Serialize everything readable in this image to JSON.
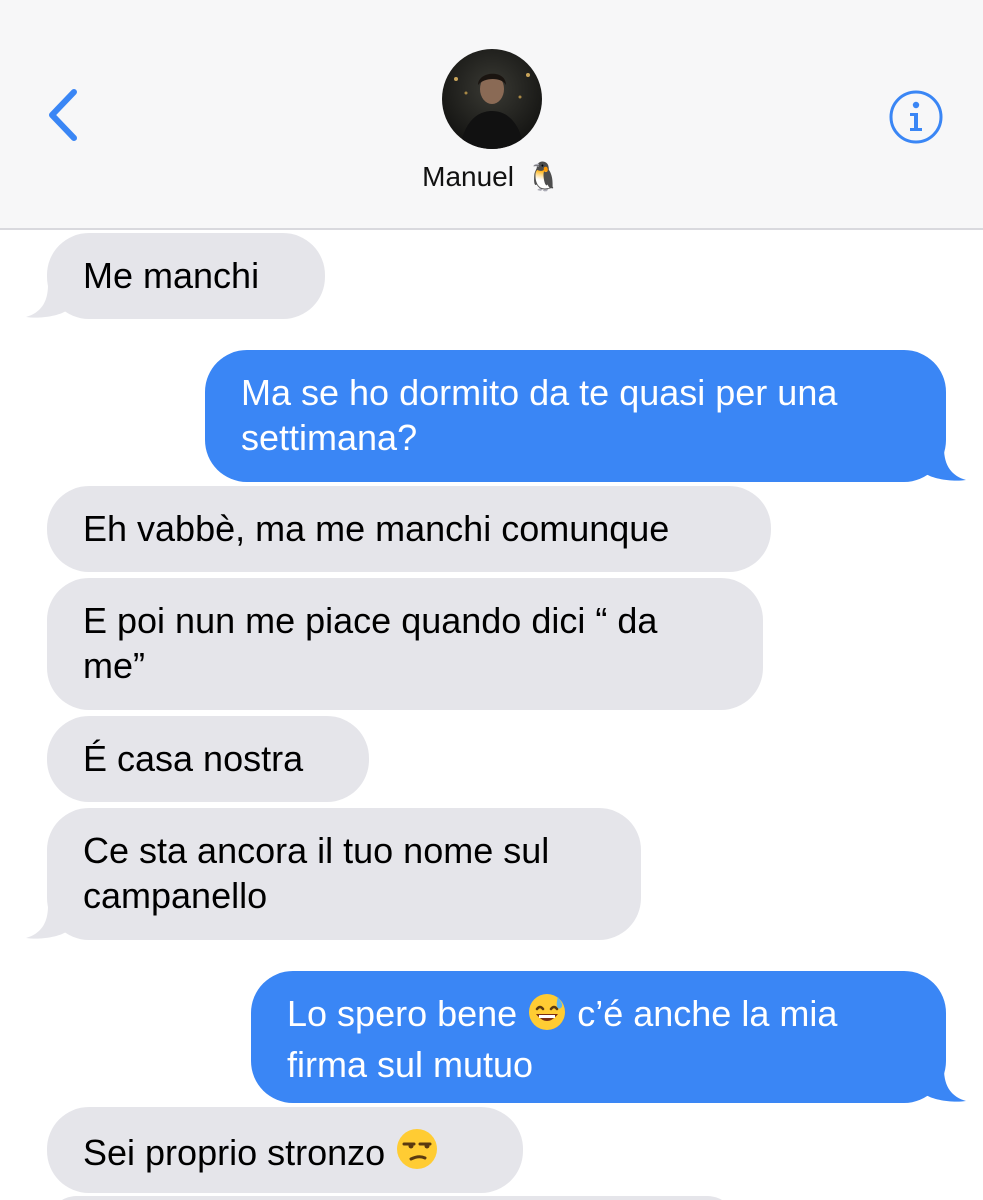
{
  "header": {
    "back_icon": "chevron-left-icon",
    "contact_name": "Manuel",
    "contact_emoji": "🐧",
    "info_icon": "info-circle-icon",
    "accent_color": "#3a86f5"
  },
  "messages": [
    {
      "direction": "received",
      "text": "Me manchi"
    },
    {
      "direction": "sent",
      "text": "Ma se ho dormito da te quasi per una settimana?"
    },
    {
      "direction": "received",
      "text": "Eh vabbè, ma me manchi comunque"
    },
    {
      "direction": "received",
      "text": "E poi nun me piace quando dici “ da me”"
    },
    {
      "direction": "received",
      "text": "É casa nostra"
    },
    {
      "direction": "received",
      "text": "Ce sta ancora il tuo nome sul campanello"
    },
    {
      "direction": "sent",
      "text_before": "Lo spero bene",
      "emoji": "😅",
      "text_after": "c’é anche la mia firma sul mutuo"
    },
    {
      "direction": "received",
      "text_before": "Sei proprio stronzo",
      "emoji": "😒"
    }
  ],
  "colors": {
    "sent_bubble": "#3a86f5",
    "received_bubble": "#e5e5ea",
    "header_bg": "#f7f7f8"
  }
}
